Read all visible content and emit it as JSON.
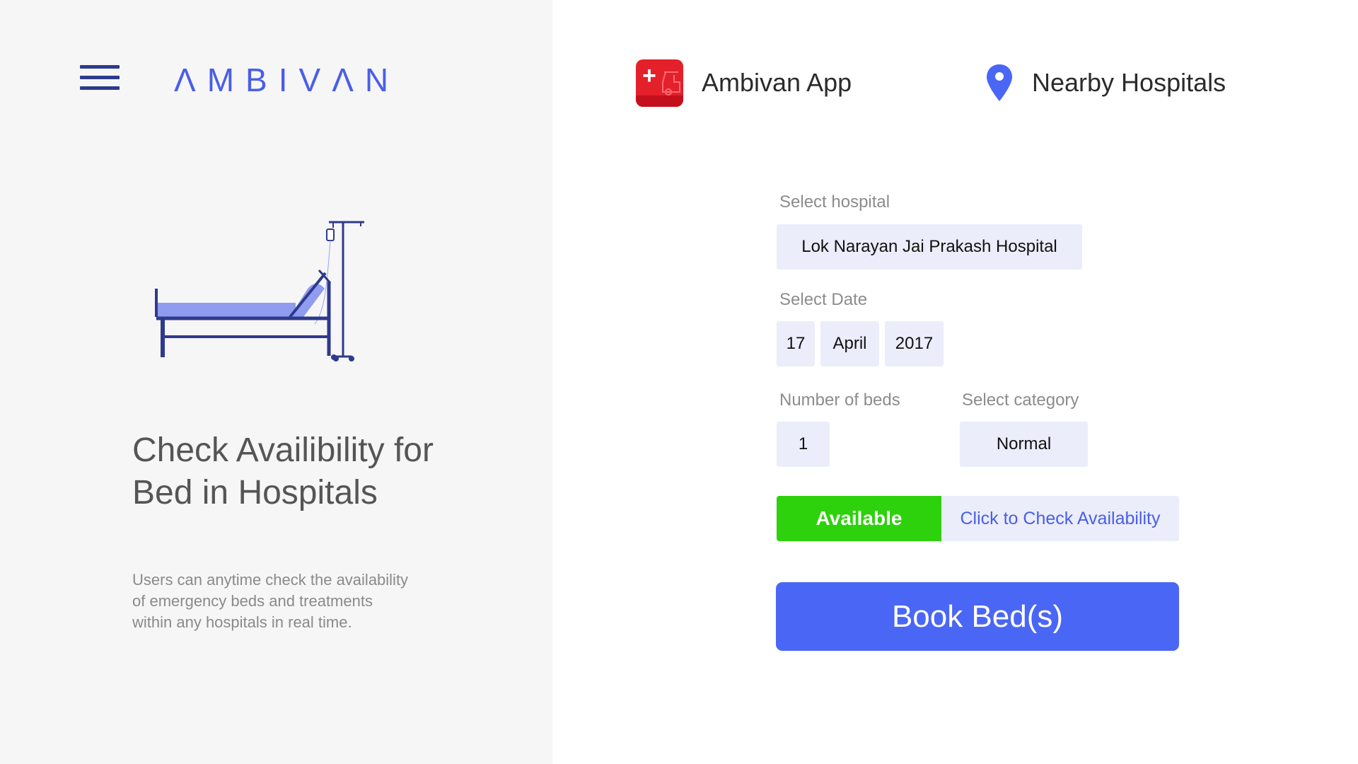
{
  "brand": {
    "logo_text": "ΛMBIVΛN",
    "accent_color": "#4a5ee8"
  },
  "header": {
    "app_link_label": "Ambivan App",
    "hospitals_link_label": "Nearby Hospitals"
  },
  "hero": {
    "headline_line1": "Check Availibility for",
    "headline_line2": "Bed in Hospitals",
    "description_line1": "Users can anytime check the availability",
    "description_line2": "of emergency beds and treatments",
    "description_line3": "within any hospitals in real time."
  },
  "form": {
    "hospital_label": "Select hospital",
    "hospital_value": "Lok Narayan Jai Prakash Hospital",
    "date_label": "Select Date",
    "date_day": "17",
    "date_month": "April",
    "date_year": "2017",
    "beds_label": "Number of beds",
    "beds_value": "1",
    "category_label": "Select category",
    "category_value": "Normal",
    "status_text": "Available",
    "status_color": "#2dd10c",
    "check_link_label": "Click to Check Availability",
    "book_button_label": "Book Bed(s)"
  }
}
